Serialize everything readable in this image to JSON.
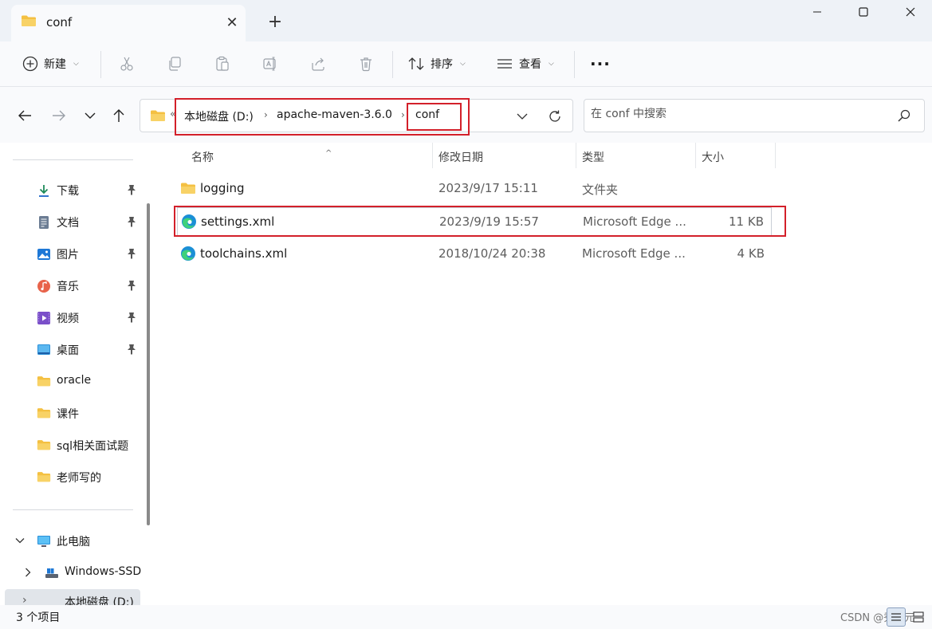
{
  "tab": {
    "title": "conf"
  },
  "toolbar": {
    "new_label": "新建",
    "sort_label": "排序",
    "view_label": "查看",
    "more_label": "···"
  },
  "address": {
    "more": "«",
    "crumbs": [
      "本地磁盘 (D:)",
      "apache-maven-3.6.0",
      "conf"
    ]
  },
  "search": {
    "placeholder": "在 conf 中搜索"
  },
  "nav": {
    "quick": [
      {
        "label": "下载",
        "icon": "download-icon",
        "pinned": true
      },
      {
        "label": "文档",
        "icon": "document-icon",
        "pinned": true
      },
      {
        "label": "图片",
        "icon": "picture-icon",
        "pinned": true
      },
      {
        "label": "音乐",
        "icon": "music-icon",
        "pinned": true
      },
      {
        "label": "视频",
        "icon": "video-icon",
        "pinned": true
      },
      {
        "label": "桌面",
        "icon": "desktop-icon",
        "pinned": true
      },
      {
        "label": "oracle",
        "icon": "folder-icon",
        "pinned": false
      },
      {
        "label": "课件",
        "icon": "folder-icon",
        "pinned": false
      },
      {
        "label": "sql相关面试题",
        "icon": "folder-icon",
        "pinned": false
      },
      {
        "label": "老师写的",
        "icon": "folder-icon",
        "pinned": false
      }
    ],
    "this_pc": "此电脑",
    "drives": [
      "Windows-SSD",
      "本地磁盘 (D:)"
    ]
  },
  "columns": {
    "name": "名称",
    "date": "修改日期",
    "type": "类型",
    "size": "大小"
  },
  "files": [
    {
      "name": "logging",
      "date": "2023/9/17 15:11",
      "type": "文件夹",
      "size": "",
      "icon": "folder-icon"
    },
    {
      "name": "settings.xml",
      "date": "2023/9/19 15:57",
      "type": "Microsoft Edge ...",
      "size": "11 KB",
      "icon": "edge-icon"
    },
    {
      "name": "toolchains.xml",
      "date": "2018/10/24 20:38",
      "type": "Microsoft Edge ...",
      "size": "4 KB",
      "icon": "edge-icon"
    }
  ],
  "status": {
    "count": "3 个项目",
    "watermark": "CSDN @秀三元"
  },
  "colors": {
    "highlight_red": "#d3202a",
    "folder_yellow": "#f4c042",
    "accent_blue": "#1e66c8"
  }
}
